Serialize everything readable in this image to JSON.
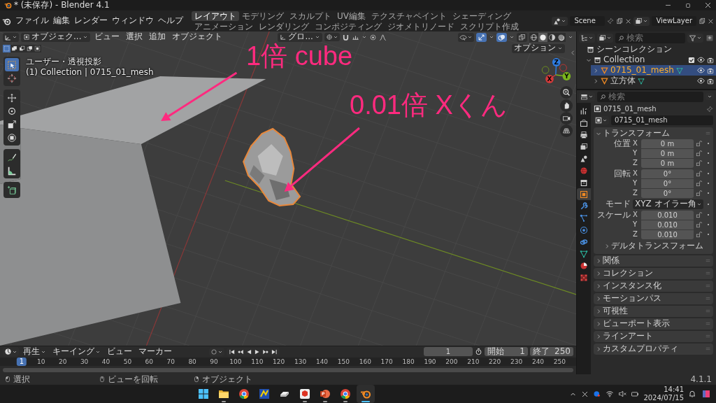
{
  "window": {
    "title": "* (未保存) - Blender 4.1"
  },
  "menus": [
    "ファイル",
    "編集",
    "レンダー",
    "ウィンドウ",
    "ヘルプ"
  ],
  "workspace_tabs": [
    {
      "label": "レイアウト",
      "selected": true
    },
    {
      "label": "モデリング",
      "selected": false
    },
    {
      "label": "スカルプト",
      "selected": false
    },
    {
      "label": "UV編集",
      "selected": false
    },
    {
      "label": "テクスチャペイント",
      "selected": false
    },
    {
      "label": "シェーディング",
      "selected": false
    },
    {
      "label": "アニメーション",
      "selected": false
    },
    {
      "label": "レンダリング",
      "selected": false
    },
    {
      "label": "コンポジティング",
      "selected": false
    },
    {
      "label": "ジオメトリノード",
      "selected": false
    },
    {
      "label": "スクリプト作成",
      "selected": false
    }
  ],
  "scene": {
    "name": "Scene"
  },
  "view_layer": {
    "name": "ViewLayer"
  },
  "viewport": {
    "mode": "オブジェク...",
    "menus": [
      "ビュー",
      "選択",
      "追加",
      "オブジェクト"
    ],
    "orientation": "グロ...",
    "overlay_toggles": [
      {
        "kind": "gizmo",
        "on": true
      },
      {
        "kind": "overlay",
        "on": true
      },
      {
        "kind": "xray",
        "on": false
      }
    ],
    "shading_modes": [
      {
        "kind": "wireframe",
        "selected": false
      },
      {
        "kind": "solid",
        "selected": true
      },
      {
        "kind": "material",
        "selected": false
      },
      {
        "kind": "rendered",
        "selected": false
      }
    ],
    "selection_modes": [
      {
        "kind": "set",
        "selected": true
      },
      {
        "kind": "extend",
        "selected": false
      },
      {
        "kind": "subtract",
        "selected": false
      },
      {
        "kind": "invert",
        "selected": false
      },
      {
        "kind": "intersect",
        "selected": false
      }
    ],
    "options": "オプション",
    "view_name": "ユーザー・透視投影",
    "object_info": "(1) Collection | 0715_01_mesh",
    "tool_groups": [
      {
        "tools": [
          {
            "kind": "select",
            "selected": true
          },
          {
            "kind": "cursor",
            "selected": false
          }
        ]
      },
      {
        "tools": [
          {
            "kind": "move",
            "selected": false
          },
          {
            "kind": "rotate",
            "selected": false
          },
          {
            "kind": "scale",
            "selected": false
          },
          {
            "kind": "transform",
            "selected": false
          }
        ]
      },
      {
        "tools": [
          {
            "kind": "annotate",
            "selected": false
          },
          {
            "kind": "measure",
            "selected": false
          }
        ]
      },
      {
        "tools": [
          {
            "kind": "add_cube",
            "selected": false
          }
        ]
      }
    ],
    "gizmo_axes": [
      {
        "kind": "z",
        "label": "Z"
      },
      {
        "kind": "y",
        "label": "Y"
      },
      {
        "kind": "x",
        "label": "X"
      }
    ],
    "annotations": [
      {
        "text": "1倍 cube"
      },
      {
        "text": "0.01倍 Xくん"
      }
    ]
  },
  "outliner": {
    "search_placeholder": "検索",
    "tree": [
      {
        "kind": "scene_collection",
        "label": "シーンコレクション",
        "selected": false,
        "children": [
          {
            "kind": "collection",
            "label": "Collection",
            "expanded": true,
            "checked": true,
            "selected": false,
            "children": [
              {
                "kind": "mesh",
                "label": "0715_01_mesh",
                "expanded": false,
                "selected": true
              },
              {
                "kind": "mesh",
                "label": "立方体",
                "expanded": false,
                "selected": false
              }
            ]
          }
        ]
      }
    ]
  },
  "properties": {
    "search_placeholder": "検索",
    "tabs": [
      {
        "kind": "tool",
        "selected": false
      },
      {
        "kind": "render",
        "selected": false
      },
      {
        "kind": "output",
        "selected": false
      },
      {
        "kind": "view_layer",
        "selected": false
      },
      {
        "kind": "scene",
        "selected": false
      },
      {
        "kind": "world",
        "selected": false
      },
      {
        "kind": "collection",
        "selected": false
      },
      {
        "kind": "object",
        "selected": true
      },
      {
        "kind": "modifier",
        "selected": false
      },
      {
        "kind": "particles",
        "selected": false
      },
      {
        "kind": "physics",
        "selected": false
      },
      {
        "kind": "constraint",
        "selected": false
      },
      {
        "kind": "data",
        "selected": false
      },
      {
        "kind": "material",
        "selected": false
      },
      {
        "kind": "texture",
        "selected": false
      }
    ],
    "object_name": "0715_01_mesh",
    "data_name": "0715_01_mesh",
    "transform": {
      "title": "トランスフォーム",
      "expanded": true,
      "rows": [
        {
          "kind": "vector",
          "label": "位置",
          "axes": [
            {
              "axis": "X",
              "value": "0 m"
            },
            {
              "axis": "Y",
              "value": "0 m"
            },
            {
              "axis": "Z",
              "value": "0 m"
            }
          ]
        },
        {
          "kind": "vector",
          "label": "回転",
          "axes": [
            {
              "axis": "X",
              "value": "0°"
            },
            {
              "axis": "Y",
              "value": "0°"
            },
            {
              "axis": "Z",
              "value": "0°"
            }
          ]
        },
        {
          "kind": "dropdown",
          "label": "モード",
          "value": "XYZ オイラー角"
        },
        {
          "kind": "vector",
          "label": "スケール",
          "axes": [
            {
              "axis": "X",
              "value": "0.010"
            },
            {
              "axis": "Y",
              "value": "0.010"
            },
            {
              "axis": "Z",
              "value": "0.010"
            }
          ]
        }
      ],
      "subpanel": {
        "title": "デルタトランスフォーム",
        "expanded": false
      }
    },
    "panels": [
      {
        "title": "関係",
        "expanded": false
      },
      {
        "title": "コレクション",
        "expanded": false
      },
      {
        "title": "インスタンス化",
        "expanded": false
      },
      {
        "title": "モーションパス",
        "expanded": false
      },
      {
        "title": "可視性",
        "expanded": false
      },
      {
        "title": "ビューポート表示",
        "expanded": false
      },
      {
        "title": "ラインアート",
        "expanded": false
      },
      {
        "title": "カスタムプロパティ",
        "expanded": false
      }
    ]
  },
  "timeline": {
    "menus": [
      {
        "label": "再生",
        "kind": "dropdown"
      },
      {
        "label": "キーイング",
        "kind": "dropdown"
      },
      {
        "label": "ビュー",
        "kind": "menu"
      },
      {
        "label": "マーカー",
        "kind": "menu"
      }
    ],
    "current_frame": "1",
    "start": {
      "label": "開始",
      "value": "1"
    },
    "end": {
      "label": "終了",
      "value": "250"
    },
    "ruler_current": "1",
    "ruler_labels": [
      "10",
      "20",
      "30",
      "40",
      "50",
      "60",
      "70",
      "80",
      "90",
      "100",
      "110",
      "120",
      "130",
      "140",
      "150",
      "160",
      "170",
      "180",
      "190",
      "200",
      "210",
      "220",
      "230",
      "240",
      "250"
    ]
  },
  "status_bar": {
    "hints": [
      {
        "kind": "left",
        "text": "選択"
      },
      {
        "kind": "middle",
        "text": "ビューを回転"
      },
      {
        "kind": "right",
        "text": "オブジェクト"
      }
    ],
    "version": "4.1.1"
  },
  "taskbar": {
    "apps": [
      {
        "kind": "start",
        "running": false,
        "selected": false
      },
      {
        "kind": "folder",
        "running": true,
        "selected": false
      },
      {
        "kind": "browser",
        "running": false,
        "selected": false
      },
      {
        "kind": "game",
        "running": false,
        "selected": false
      },
      {
        "kind": "drive",
        "running": false,
        "selected": false
      },
      {
        "kind": "cube",
        "running": true,
        "selected": false
      },
      {
        "kind": "slides",
        "running": true,
        "selected": false
      },
      {
        "kind": "browser",
        "running": true,
        "selected": false
      },
      {
        "kind": "blender",
        "running": true,
        "selected": true
      }
    ],
    "time": "14:41",
    "date": "2024/07/15"
  }
}
